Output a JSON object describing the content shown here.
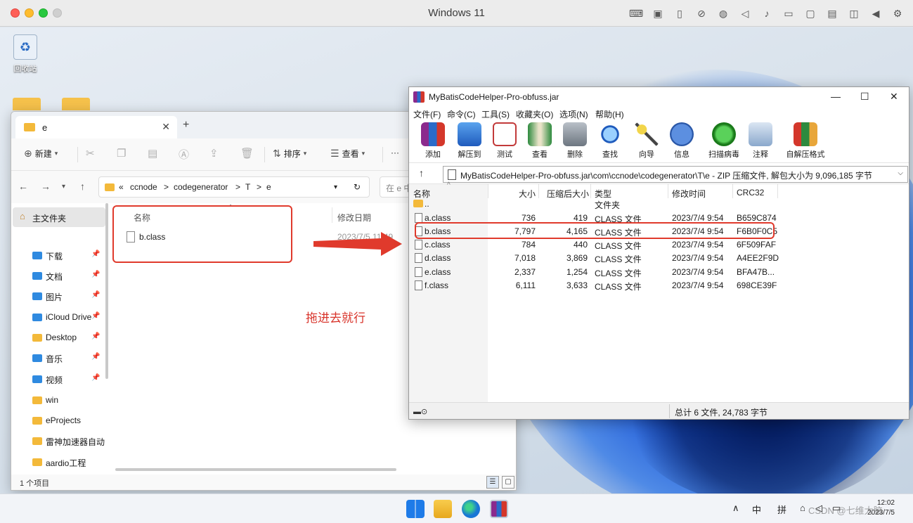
{
  "host": {
    "title": "Windows 11",
    "tools": [
      "keyboard-icon",
      "cpu-icon",
      "usb-icon",
      "no-camera-icon",
      "globe-icon",
      "speaker-icon",
      "microphone-icon",
      "drive-icon",
      "video-icon",
      "terminal-icon",
      "screen-icon",
      "back-icon",
      "gear-icon"
    ]
  },
  "desktop": {
    "recycle_bin_label": "回收站"
  },
  "explorer": {
    "tab_title": "e",
    "toolbar": {
      "new_label": "新建",
      "sort_label": "排序",
      "view_label": "查看",
      "more_label": "···"
    },
    "breadcrumb": [
      "«",
      "ccnode",
      ">",
      "codegenerator",
      ">",
      "T",
      ">",
      "e"
    ],
    "search_placeholder": "在 e 中",
    "sidebar": {
      "home_label": "主文件夹",
      "items": [
        {
          "label": "下载",
          "pinned": true,
          "color": "blue"
        },
        {
          "label": "文档",
          "pinned": true,
          "color": "blue"
        },
        {
          "label": "图片",
          "pinned": true,
          "color": "blue"
        },
        {
          "label": "iCloud Drive",
          "pinned": true,
          "color": "blue"
        },
        {
          "label": "Desktop",
          "pinned": true,
          "color": "yellow"
        },
        {
          "label": "音乐",
          "pinned": true,
          "color": "blue"
        },
        {
          "label": "视频",
          "pinned": true,
          "color": "blue"
        },
        {
          "label": "win",
          "pinned": false,
          "color": "yellow"
        },
        {
          "label": "eProjects",
          "pinned": false,
          "color": "yellow"
        },
        {
          "label": "雷神加速器自动",
          "pinned": false,
          "color": "yellow"
        },
        {
          "label": "aardio工程",
          "pinned": false,
          "color": "yellow"
        }
      ]
    },
    "columns": {
      "name": "名称",
      "date": "修改日期"
    },
    "files": [
      {
        "name": "b.class",
        "date": "2023/7/5 11:49"
      }
    ],
    "status": "1 个项目"
  },
  "annotation": {
    "text": "拖进去就行",
    "color": "#e03a2c"
  },
  "winrar": {
    "title": "MyBatisCodeHelper-Pro-obfuss.jar",
    "menu": [
      "文件(F)",
      "命令(C)",
      "工具(S)",
      "收藏夹(O)",
      "选项(N)",
      "帮助(H)"
    ],
    "toolbar": [
      "添加",
      "解压到",
      "测试",
      "查看",
      "删除",
      "查找",
      "向导",
      "信息",
      "扫描病毒",
      "注释",
      "自解压格式"
    ],
    "address": "MyBatisCodeHelper-Pro-obfuss.jar\\com\\ccnode\\codegenerator\\T\\e - ZIP 压缩文件, 解包大小为 9,096,185 字节",
    "columns": {
      "name": "名称",
      "size": "大小",
      "packed": "压缩后大小",
      "type": "类型",
      "modified": "修改时间",
      "crc": "CRC32"
    },
    "rows": [
      {
        "name": "..",
        "size": "",
        "packed": "",
        "type": "文件夹",
        "modified": "",
        "crc": "",
        "folder": true
      },
      {
        "name": "a.class",
        "size": "736",
        "packed": "419",
        "type": "CLASS 文件",
        "modified": "2023/7/4 9:54",
        "crc": "B659C874"
      },
      {
        "name": "b.class",
        "size": "7,797",
        "packed": "4,165",
        "type": "CLASS 文件",
        "modified": "2023/7/4 9:54",
        "crc": "F6B0F0C5"
      },
      {
        "name": "c.class",
        "size": "784",
        "packed": "440",
        "type": "CLASS 文件",
        "modified": "2023/7/4 9:54",
        "crc": "6F509FAF"
      },
      {
        "name": "d.class",
        "size": "7,018",
        "packed": "3,869",
        "type": "CLASS 文件",
        "modified": "2023/7/4 9:54",
        "crc": "A4EE2F9D"
      },
      {
        "name": "e.class",
        "size": "2,337",
        "packed": "1,254",
        "type": "CLASS 文件",
        "modified": "2023/7/4 9:54",
        "crc": "BFA47B..."
      },
      {
        "name": "f.class",
        "size": "6,111",
        "packed": "3,633",
        "type": "CLASS 文件",
        "modified": "2023/7/4 9:54",
        "crc": "698CE39F"
      }
    ],
    "status": "总计 6 文件, 24,783 字节"
  },
  "taskbar": {
    "ime_mode": "中",
    "ime_layout": "拼",
    "time": "12:02",
    "date": "2023/7/5",
    "watermark": "CSDN @七维大脑"
  }
}
